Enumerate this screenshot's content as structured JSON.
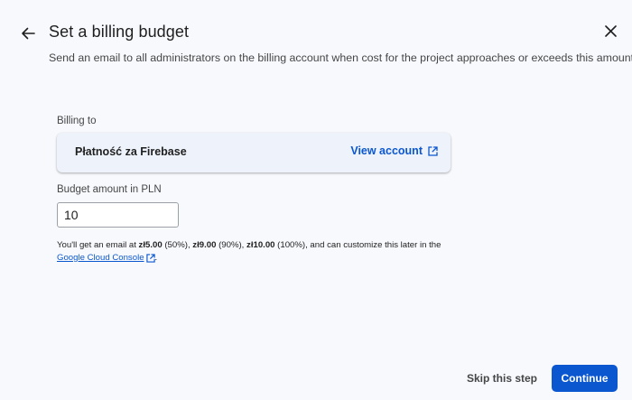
{
  "header": {
    "title": "Set a billing budget",
    "subtitle": "Send an email to all administrators on the billing account when cost for the project approaches or exceeds this amount"
  },
  "billing": {
    "label": "Billing to",
    "account_name": "Płatność za Firebase",
    "view_account_label": "View account"
  },
  "budget": {
    "label": "Budget amount in PLN",
    "value": "10"
  },
  "info": {
    "prefix": "You'll get an email at ",
    "amount1": "zł5.00",
    "pct1": " (50%), ",
    "amount2": "zł9.00",
    "pct2": " (90%), ",
    "amount3": "zł10.00",
    "pct3": " (100%), and can customize this later in the",
    "link_label": "Google Cloud Console",
    "suffix": "."
  },
  "footer": {
    "skip_label": "Skip this step",
    "continue_label": "Continue"
  },
  "colors": {
    "accent": "#0b57d0",
    "background": "#f8f9fd",
    "card": "#eef2fa"
  },
  "icons": {
    "back": "arrow-back-icon",
    "close": "close-icon",
    "external": "open-in-new-icon"
  }
}
